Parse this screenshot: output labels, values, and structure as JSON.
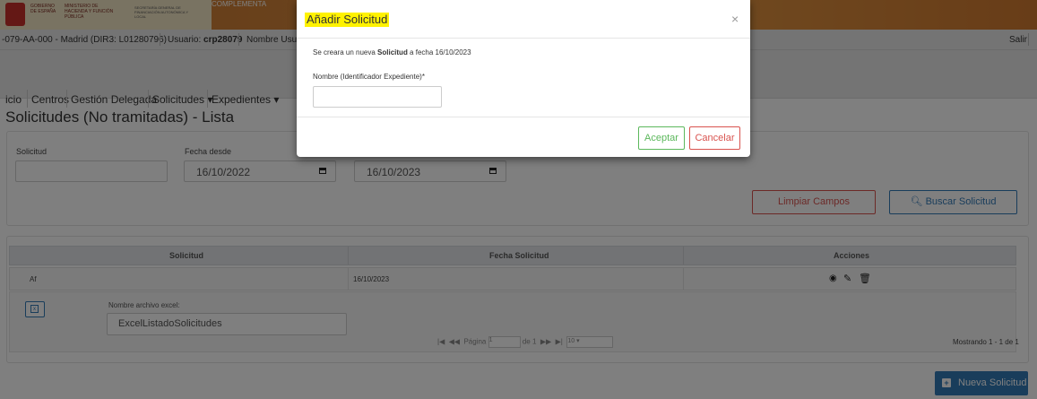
{
  "header": {
    "logo_gobierno": "GOBIERNO DE ESPAÑA",
    "logo_ministerio": "MINISTERIO DE HACIENDA Y FUNCIÓN PÚBLICA",
    "logo_secretaria": "SECRETARÍA GENERAL DE FINANCIACIÓN AUTONÓMICA Y LOCAL",
    "app_banner": "COMPLEMENTA"
  },
  "userbar": {
    "entity": "-079-AA-000 - Madrid (DIR3: L01280796)",
    "user_prefix": "Usuario: ",
    "user_id": "crp28079",
    "name_label": "Nombre Usuar",
    "logout": "Salir"
  },
  "nav": {
    "items": [
      {
        "label": "icio"
      },
      {
        "label": "Centros"
      },
      {
        "label": "Gestión Delegada"
      },
      {
        "label": "Solicitudes ▾"
      },
      {
        "label": "Expedientes ▾"
      }
    ]
  },
  "page": {
    "title": "Solicitudes (No tramitadas) - Lista"
  },
  "filters": {
    "solicitud_label": "Solicitud",
    "solicitud_value": "",
    "fecha_desde_label": "Fecha desde",
    "fecha_desde_value": "16/10/2022",
    "fecha_hasta_value": "16/10/2023",
    "clear_label": "Limpiar Campos",
    "search_label": "Buscar Solicitud"
  },
  "table": {
    "columns": [
      "Solicitud",
      "Fecha Solicitud",
      "Acciones"
    ],
    "rows": [
      {
        "solicitud": "Af",
        "fecha": "16/10/2023"
      }
    ],
    "excel_label": "Nombre archivo excel:",
    "excel_value": "ExcelListadoSolicitudes",
    "pager_page_label": "Página",
    "pager_page_value": "1",
    "pager_of": "de 1",
    "pager_size": "10",
    "showing": "Mostrando 1 - 1 de 1"
  },
  "actions": {
    "new_label": "Nueva Solicitud"
  },
  "modal": {
    "title": "Añadir Solicitud",
    "close": "×",
    "info_prefix": "Se creara un nueva ",
    "info_bold": "Solicitud",
    "info_suffix": " a fecha 16/10/2023",
    "field_label": "Nombre (Identificador Expediente)*",
    "field_value": "",
    "accept_label": "Aceptar",
    "cancel_label": "Cancelar"
  },
  "colors": {
    "primary": "#337ab7",
    "danger": "#d9534f",
    "success": "#5cb85c",
    "highlight": "#fff200"
  }
}
